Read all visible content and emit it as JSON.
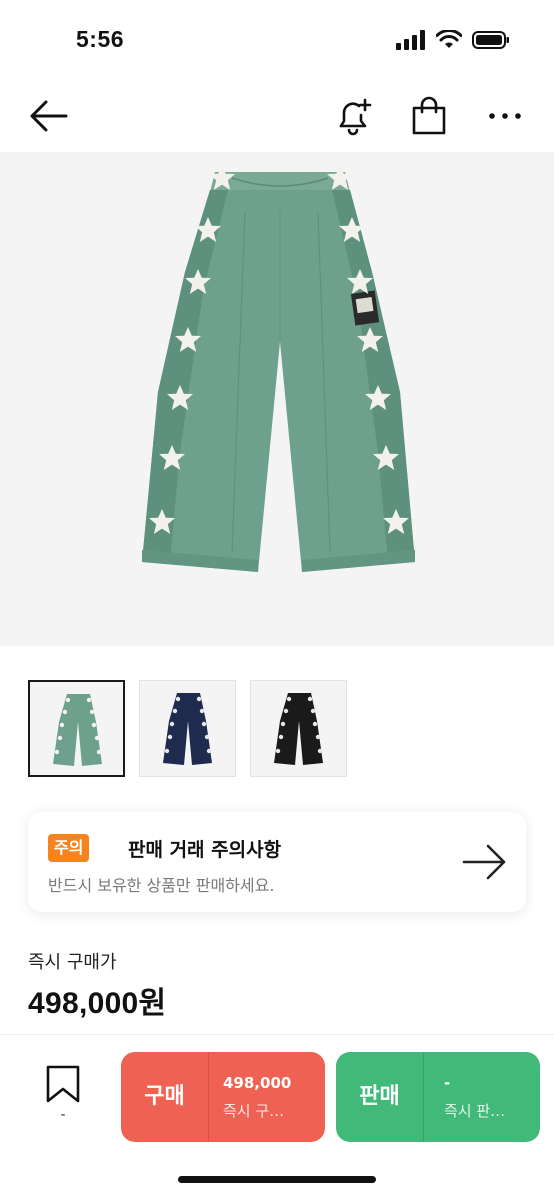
{
  "status_bar": {
    "time": "5:56"
  },
  "nav": {
    "back_icon": "arrow-left-icon",
    "icons": [
      "bell-plus-icon",
      "shopping-bag-icon",
      "more-icon"
    ]
  },
  "product": {
    "main_image": "green-track-pants-with-stars",
    "thumbnails": [
      {
        "color": "#6ea18d",
        "star": "#f3f3ee",
        "selected": true
      },
      {
        "color": "#1e2a4e",
        "star": "#e8e8e8",
        "selected": false
      },
      {
        "color": "#1a1a1a",
        "star": "#e8e8e8",
        "selected": false
      }
    ]
  },
  "notice": {
    "badge": "주의",
    "title": "판매 거래 주의사항",
    "description": "반드시 보유한 상품만 판매하세요."
  },
  "price": {
    "label": "즉시 구매가",
    "value": "498,000원"
  },
  "bottom_bar": {
    "bookmark_count": "-",
    "buy": {
      "label": "구매",
      "price": "498,000",
      "sub": "즉시 구…"
    },
    "sell": {
      "label": "판매",
      "price": "-",
      "sub": "즉시 판…"
    }
  },
  "colors": {
    "buy": "#ef6253",
    "sell": "#41b979",
    "badge": "#f5841f",
    "pants_green": "#6ea18d"
  }
}
